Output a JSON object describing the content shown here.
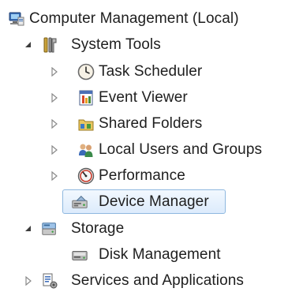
{
  "tree": {
    "root": {
      "label": "Computer Management (Local)",
      "icon": "computer-management-icon"
    },
    "system_tools": {
      "label": "System Tools",
      "icon": "tools-icon",
      "expanded": true,
      "children": [
        {
          "label": "Task Scheduler",
          "icon": "clock-icon",
          "expandable": true
        },
        {
          "label": "Event Viewer",
          "icon": "event-viewer-icon",
          "expandable": true
        },
        {
          "label": "Shared Folders",
          "icon": "shared-folder-icon",
          "expandable": true
        },
        {
          "label": "Local Users and Groups",
          "icon": "users-icon",
          "expandable": true
        },
        {
          "label": "Performance",
          "icon": "performance-icon",
          "expandable": true
        },
        {
          "label": "Device Manager",
          "icon": "device-manager-icon",
          "expandable": false,
          "selected": true
        }
      ]
    },
    "storage": {
      "label": "Storage",
      "icon": "storage-icon",
      "expanded": true,
      "children": [
        {
          "label": "Disk Management",
          "icon": "disk-icon",
          "expandable": false
        }
      ]
    },
    "services": {
      "label": "Services and Applications",
      "icon": "services-icon",
      "expanded": false
    }
  },
  "colors": {
    "selection_border": "#8fb8e0",
    "selection_fill": "#dcebfc",
    "text": "#1e1e1e"
  }
}
